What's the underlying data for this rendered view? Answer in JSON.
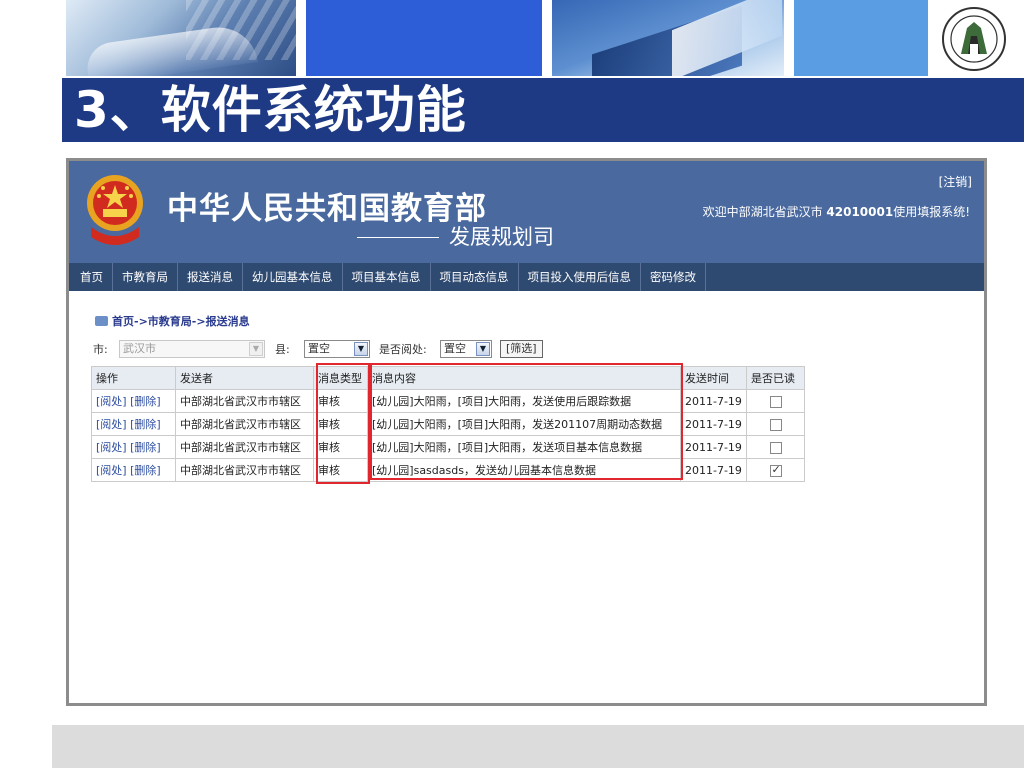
{
  "slide": {
    "title": "3、软件系统功能",
    "colors": {
      "title_band": "#1f3a85",
      "highlight": "#e0262f"
    }
  },
  "header": {
    "ministry_name": "中华人民共和国教育部",
    "department": "发展规划司",
    "logout": "[注销]",
    "welcome_prefix": "欢迎中部湖北省武汉市 ",
    "welcome_code": "42010001",
    "welcome_suffix": "使用填报系统!"
  },
  "nav": {
    "items": [
      "首页",
      "市教育局",
      "报送消息",
      "幼儿园基本信息",
      "项目基本信息",
      "项目动态信息",
      "项目投入使用后信息",
      "密码修改"
    ]
  },
  "breadcrumb": "首页->市教育局->报送消息",
  "filters": {
    "city_label": "市:",
    "city_value": "武汉市",
    "county_label": "县:",
    "county_value": "置空",
    "read_label": "是否阅处:",
    "read_value": "置空",
    "filter_button": "[筛选]"
  },
  "table": {
    "headers": [
      "操作",
      "发送者",
      "消息类型",
      "消息内容",
      "发送时间",
      "是否已读"
    ],
    "rows": [
      {
        "op_read": "[阅处]",
        "op_delete": "[删除]",
        "sender": "中部湖北省武汉市市辖区",
        "type": "审核",
        "content": "[幼儿园]大阳雨，[项目]大阳雨，发送使用后跟踪数据",
        "time": "2011-7-19",
        "read": false
      },
      {
        "op_read": "[阅处]",
        "op_delete": "[删除]",
        "sender": "中部湖北省武汉市市辖区",
        "type": "审核",
        "content": "[幼儿园]大阳雨，[项目]大阳雨，发送201107周期动态数据",
        "time": "2011-7-19",
        "read": false
      },
      {
        "op_read": "[阅处]",
        "op_delete": "[删除]",
        "sender": "中部湖北省武汉市市辖区",
        "type": "审核",
        "content": "[幼儿园]大阳雨，[项目]大阳雨，发送项目基本信息数据",
        "time": "2011-7-19",
        "read": false
      },
      {
        "op_read": "[阅处]",
        "op_delete": "[删除]",
        "sender": "中部湖北省武汉市市辖区",
        "type": "审核",
        "content": "[幼儿园]sasdasds，发送幼儿园基本信息数据",
        "time": "2011-7-19",
        "read": true
      }
    ]
  }
}
